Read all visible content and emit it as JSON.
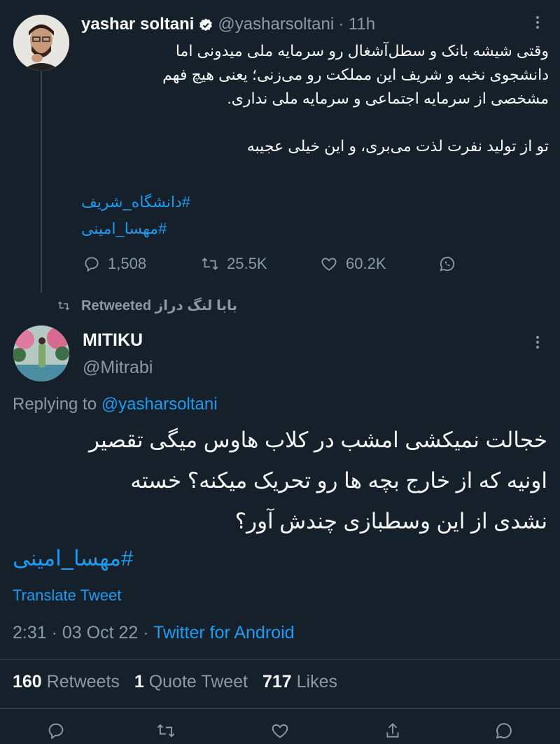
{
  "first_tweet": {
    "display_name": "yashar soltani",
    "handle": "@yasharsoltani",
    "time": "· 11h",
    "lines": [
      "وقتی شیشه بانک و سطل‌آشغال رو سرمایه ملی میدونی اما",
      "دانشجوی نخبه و شریف این مملکت رو می‌زنی؛ یعنی هیچ فهم",
      "مشخصی از سرمایه اجتماعی و سرمایه ملی نداری.",
      "تو از تولید نفرت لذت می‌بری، و این خیلی عجیبه"
    ],
    "hashtags": [
      "#دانشگاه_شریف",
      "#مهسا_امینی"
    ],
    "replies": "1,508",
    "retweets": "25.5K",
    "likes": "60.2K"
  },
  "retweet_note": {
    "text": "بابا لنگ دراز Retweeted"
  },
  "main_tweet": {
    "display_name": "MITIKU",
    "handle": "@Mitrabi",
    "replying_prefix": "Replying to",
    "replying_handle": "@yasharsoltani",
    "lines": [
      "خجالت نمیکشی امشب در کلاب هاوس میگی تقصیر",
      "اونیه که از خارج بچه ها رو تحریک میکنه؟ خسته",
      "نشدی از این وسطبازی چندش آور؟"
    ],
    "hashtag": "#مهسا_امینی",
    "translate": "Translate Tweet",
    "timestamp": "2:31 · 03 Oct 22 ·",
    "source": "Twitter for Android",
    "stats": {
      "retweets_count": "160",
      "retweets_label": "Retweets",
      "quotes_count": "1",
      "quotes_label": "Quote Tweet",
      "likes_count": "717",
      "likes_label": "Likes"
    }
  },
  "colors": {
    "background": "#15202b",
    "accent": "#1d9bf0",
    "muted": "#8b98a5",
    "divider": "#38444d"
  },
  "icons": [
    "verified-badge-icon",
    "reply-icon",
    "retweet-icon",
    "like-icon",
    "share-icon",
    "more-icon"
  ]
}
